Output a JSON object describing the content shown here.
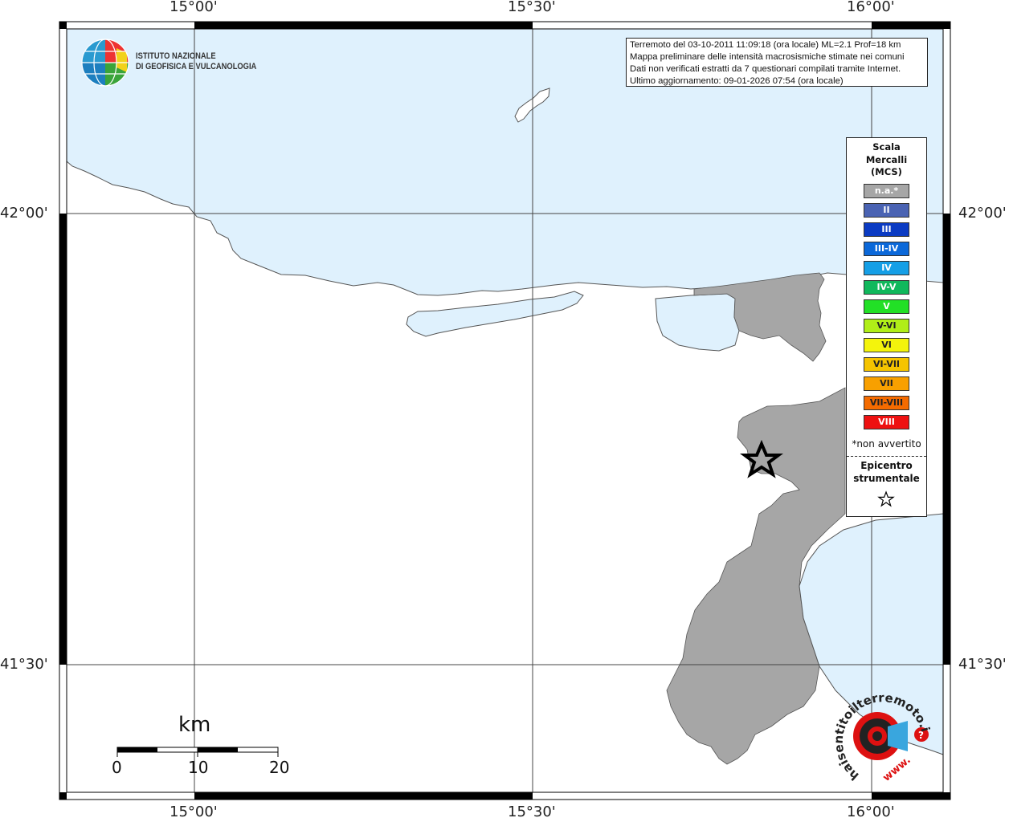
{
  "map": {
    "lon_labels": [
      "15°00'",
      "15°30'",
      "16°00'"
    ],
    "lat_labels": [
      "42°00'",
      "41°30'"
    ],
    "colors": {
      "sea": "#dff1fd",
      "land": "#ffffff",
      "affected_area": "#a6a6a6",
      "coast": "#555555"
    }
  },
  "info_box": {
    "line1": "Terremoto del 03-10-2011 11:09:18 (ora locale) ML=2.1 Prof=18 km",
    "line2": "Mappa preliminare delle intensità macrosismiche stimate nei comuni",
    "line3": "Dati non verificati estratti da 7 questionari compilati tramite Internet.",
    "line4": "Ultimo aggiornamento: 09-01-2026 07:54 (ora locale)"
  },
  "institute_logo": {
    "line1": "ISTITUTO NAZIONALE",
    "line2": "DI GEOFISICA E VULCANOLOGIA"
  },
  "legend": {
    "title_line1": "Scala",
    "title_line2": "Mercalli",
    "title_line3": "(MCS)",
    "items": [
      {
        "label": "n.a.*",
        "color": "#a6a6a6"
      },
      {
        "label": "II",
        "color": "#4a63b3"
      },
      {
        "label": "III",
        "color": "#0b3bc3"
      },
      {
        "label": "III-IV",
        "color": "#0b68d9"
      },
      {
        "label": "IV",
        "color": "#159fe6"
      },
      {
        "label": "IV-V",
        "color": "#10b85c"
      },
      {
        "label": "V",
        "color": "#22e026"
      },
      {
        "label": "V-VI",
        "color": "#b0ee18"
      },
      {
        "label": "VI",
        "color": "#f4f40c"
      },
      {
        "label": "VI-VII",
        "color": "#f5c400"
      },
      {
        "label": "VII",
        "color": "#f8a000"
      },
      {
        "label": "VII-VIII",
        "color": "#f46b00"
      },
      {
        "label": "VIII",
        "color": "#ee1111"
      }
    ],
    "note": "*non avvertito",
    "epicenter_line1": "Epicentro",
    "epicenter_line2": "strumentale"
  },
  "scale_bar": {
    "unit": "km",
    "ticks": [
      "0",
      "10",
      "20"
    ]
  },
  "site_logo": {
    "text": "haisentitoilterremoto.it",
    "prefix": "www."
  }
}
